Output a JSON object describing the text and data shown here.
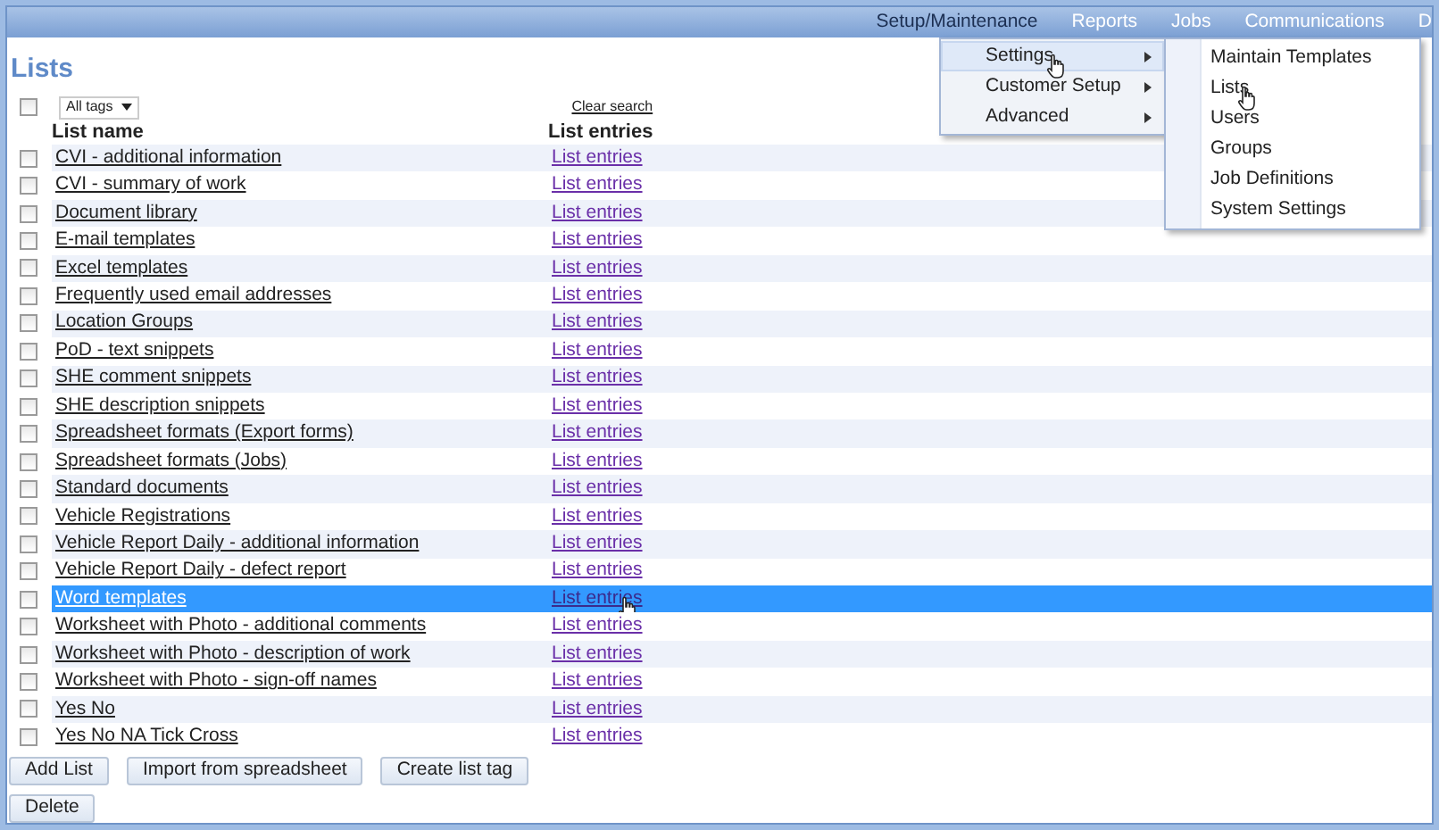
{
  "menu_bar": [
    {
      "label": "Setup/Maintenance",
      "selected": true
    },
    {
      "label": "Reports",
      "selected": false
    },
    {
      "label": "Jobs",
      "selected": false
    },
    {
      "label": "Communications",
      "selected": false
    },
    {
      "label": "D",
      "selected": false
    }
  ],
  "dropdown": [
    {
      "label": "Settings",
      "selected": true
    },
    {
      "label": "Customer Setup",
      "selected": false
    },
    {
      "label": "Advanced",
      "selected": false
    }
  ],
  "submenu": [
    {
      "label": "Maintain Templates"
    },
    {
      "label": "Lists"
    },
    {
      "label": "Users"
    },
    {
      "label": "Groups"
    },
    {
      "label": "Job Definitions"
    },
    {
      "label": "System Settings"
    }
  ],
  "title": "Lists",
  "filter": {
    "tag_select": "All tags",
    "clear_search": "Clear search",
    "select_all_checked": false
  },
  "columns": [
    "List name",
    "List entries"
  ],
  "rows": [
    {
      "name": "CVI - additional information",
      "entries": "List entries",
      "checked": false,
      "selected": false
    },
    {
      "name": "CVI - summary of work",
      "entries": "List entries",
      "checked": false,
      "selected": false
    },
    {
      "name": "Document library",
      "entries": "List entries",
      "checked": false,
      "selected": false
    },
    {
      "name": "E-mail templates",
      "entries": "List entries",
      "checked": false,
      "selected": false
    },
    {
      "name": "Excel templates",
      "entries": "List entries",
      "checked": false,
      "selected": false
    },
    {
      "name": "Frequently used email addresses",
      "entries": "List entries",
      "checked": false,
      "selected": false
    },
    {
      "name": "Location Groups",
      "entries": "List entries",
      "checked": false,
      "selected": false
    },
    {
      "name": "PoD - text snippets",
      "entries": "List entries",
      "checked": false,
      "selected": false
    },
    {
      "name": "SHE comment snippets",
      "entries": "List entries",
      "checked": false,
      "selected": false
    },
    {
      "name": "SHE description snippets",
      "entries": "List entries",
      "checked": false,
      "selected": false
    },
    {
      "name": "Spreadsheet formats (Export forms)",
      "entries": "List entries",
      "checked": false,
      "selected": false
    },
    {
      "name": "Spreadsheet formats (Jobs)",
      "entries": "List entries",
      "checked": false,
      "selected": false
    },
    {
      "name": "Standard documents",
      "entries": "List entries",
      "checked": false,
      "selected": false
    },
    {
      "name": "Vehicle Registrations",
      "entries": "List entries",
      "checked": false,
      "selected": false
    },
    {
      "name": "Vehicle Report Daily - additional information",
      "entries": "List entries",
      "checked": false,
      "selected": false
    },
    {
      "name": "Vehicle Report Daily - defect report",
      "entries": "List entries",
      "checked": false,
      "selected": false
    },
    {
      "name": "Word templates",
      "entries": "List entries",
      "checked": false,
      "selected": true
    },
    {
      "name": "Worksheet with Photo - additional comments",
      "entries": "List entries",
      "checked": false,
      "selected": false
    },
    {
      "name": "Worksheet with Photo - description of work",
      "entries": "List entries",
      "checked": false,
      "selected": false
    },
    {
      "name": "Worksheet with Photo - sign-off names",
      "entries": "List entries",
      "checked": false,
      "selected": false
    },
    {
      "name": "Yes No",
      "entries": "List entries",
      "checked": false,
      "selected": false
    },
    {
      "name": "Yes No NA Tick Cross",
      "entries": "List entries",
      "checked": false,
      "selected": false
    }
  ],
  "buttons": [
    [
      "Add List",
      "Import from spreadsheet",
      "Create list tag"
    ],
    [
      "Delete"
    ]
  ]
}
